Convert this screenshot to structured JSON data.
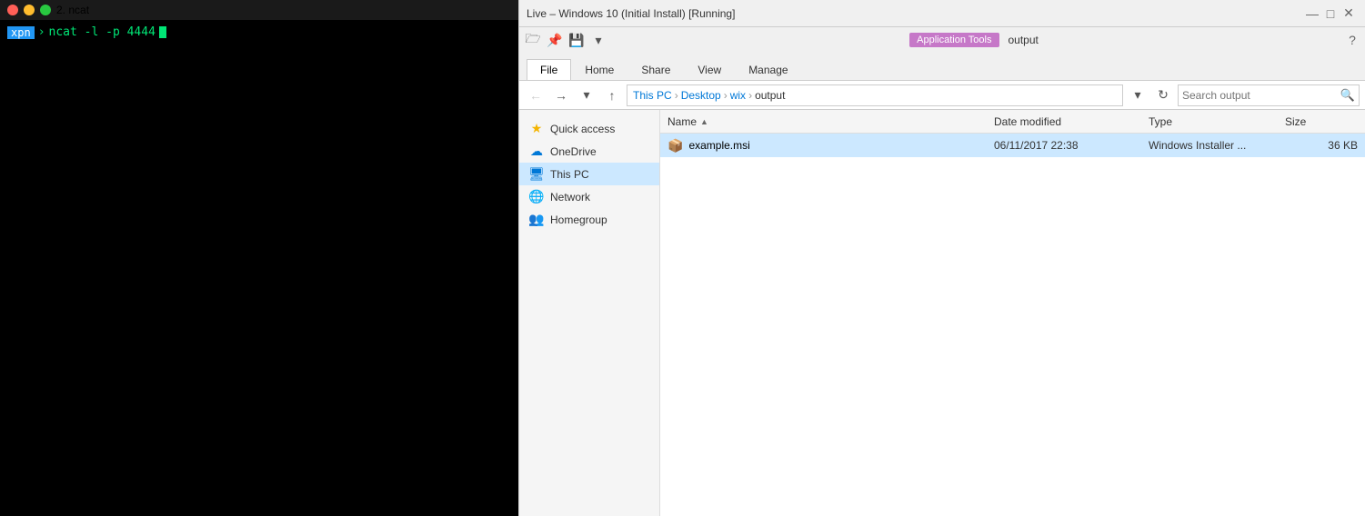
{
  "terminal": {
    "title": "2. ncat",
    "prompt": {
      "user": "xpn",
      "arrow": "›",
      "command": "ncat -l -p 4444"
    }
  },
  "explorer": {
    "titlebar": {
      "title": "Live – Windows 10  (Initial Install) [Running]",
      "minimize": "—",
      "maximize": "□",
      "close": "✕"
    },
    "ribbon": {
      "app_tools_label": "Application Tools",
      "output_tab": "output",
      "tabs": [
        {
          "label": "File",
          "active": true
        },
        {
          "label": "Home",
          "active": false
        },
        {
          "label": "Share",
          "active": false
        },
        {
          "label": "View",
          "active": false
        },
        {
          "label": "Manage",
          "active": false
        }
      ]
    },
    "addressbar": {
      "breadcrumbs": [
        {
          "label": "This PC"
        },
        {
          "label": "Desktop"
        },
        {
          "label": "wix"
        },
        {
          "label": "output"
        }
      ],
      "search_placeholder": "Search output",
      "refresh_icon": "↻",
      "dropdown_icon": "▾"
    },
    "sidebar": {
      "items": [
        {
          "id": "quick-access",
          "label": "Quick access",
          "icon": "★",
          "iconClass": "si-quickaccess",
          "active": false
        },
        {
          "id": "onedrive",
          "label": "OneDrive",
          "icon": "☁",
          "iconClass": "si-onedrive",
          "active": false
        },
        {
          "id": "this-pc",
          "label": "This PC",
          "icon": "🖥",
          "iconClass": "si-thispc",
          "active": true
        },
        {
          "id": "network",
          "label": "Network",
          "icon": "🌐",
          "iconClass": "si-network",
          "active": false
        },
        {
          "id": "homegroup",
          "label": "Homegroup",
          "icon": "👥",
          "iconClass": "si-homegroup",
          "active": false
        }
      ]
    },
    "columns": {
      "name": "Name",
      "date_modified": "Date modified",
      "type": "Type",
      "size": "Size"
    },
    "files": [
      {
        "name": "example.msi",
        "icon": "📦",
        "date_modified": "06/11/2017 22:38",
        "type": "Windows Installer ...",
        "size": "36 KB",
        "selected": true
      }
    ]
  }
}
